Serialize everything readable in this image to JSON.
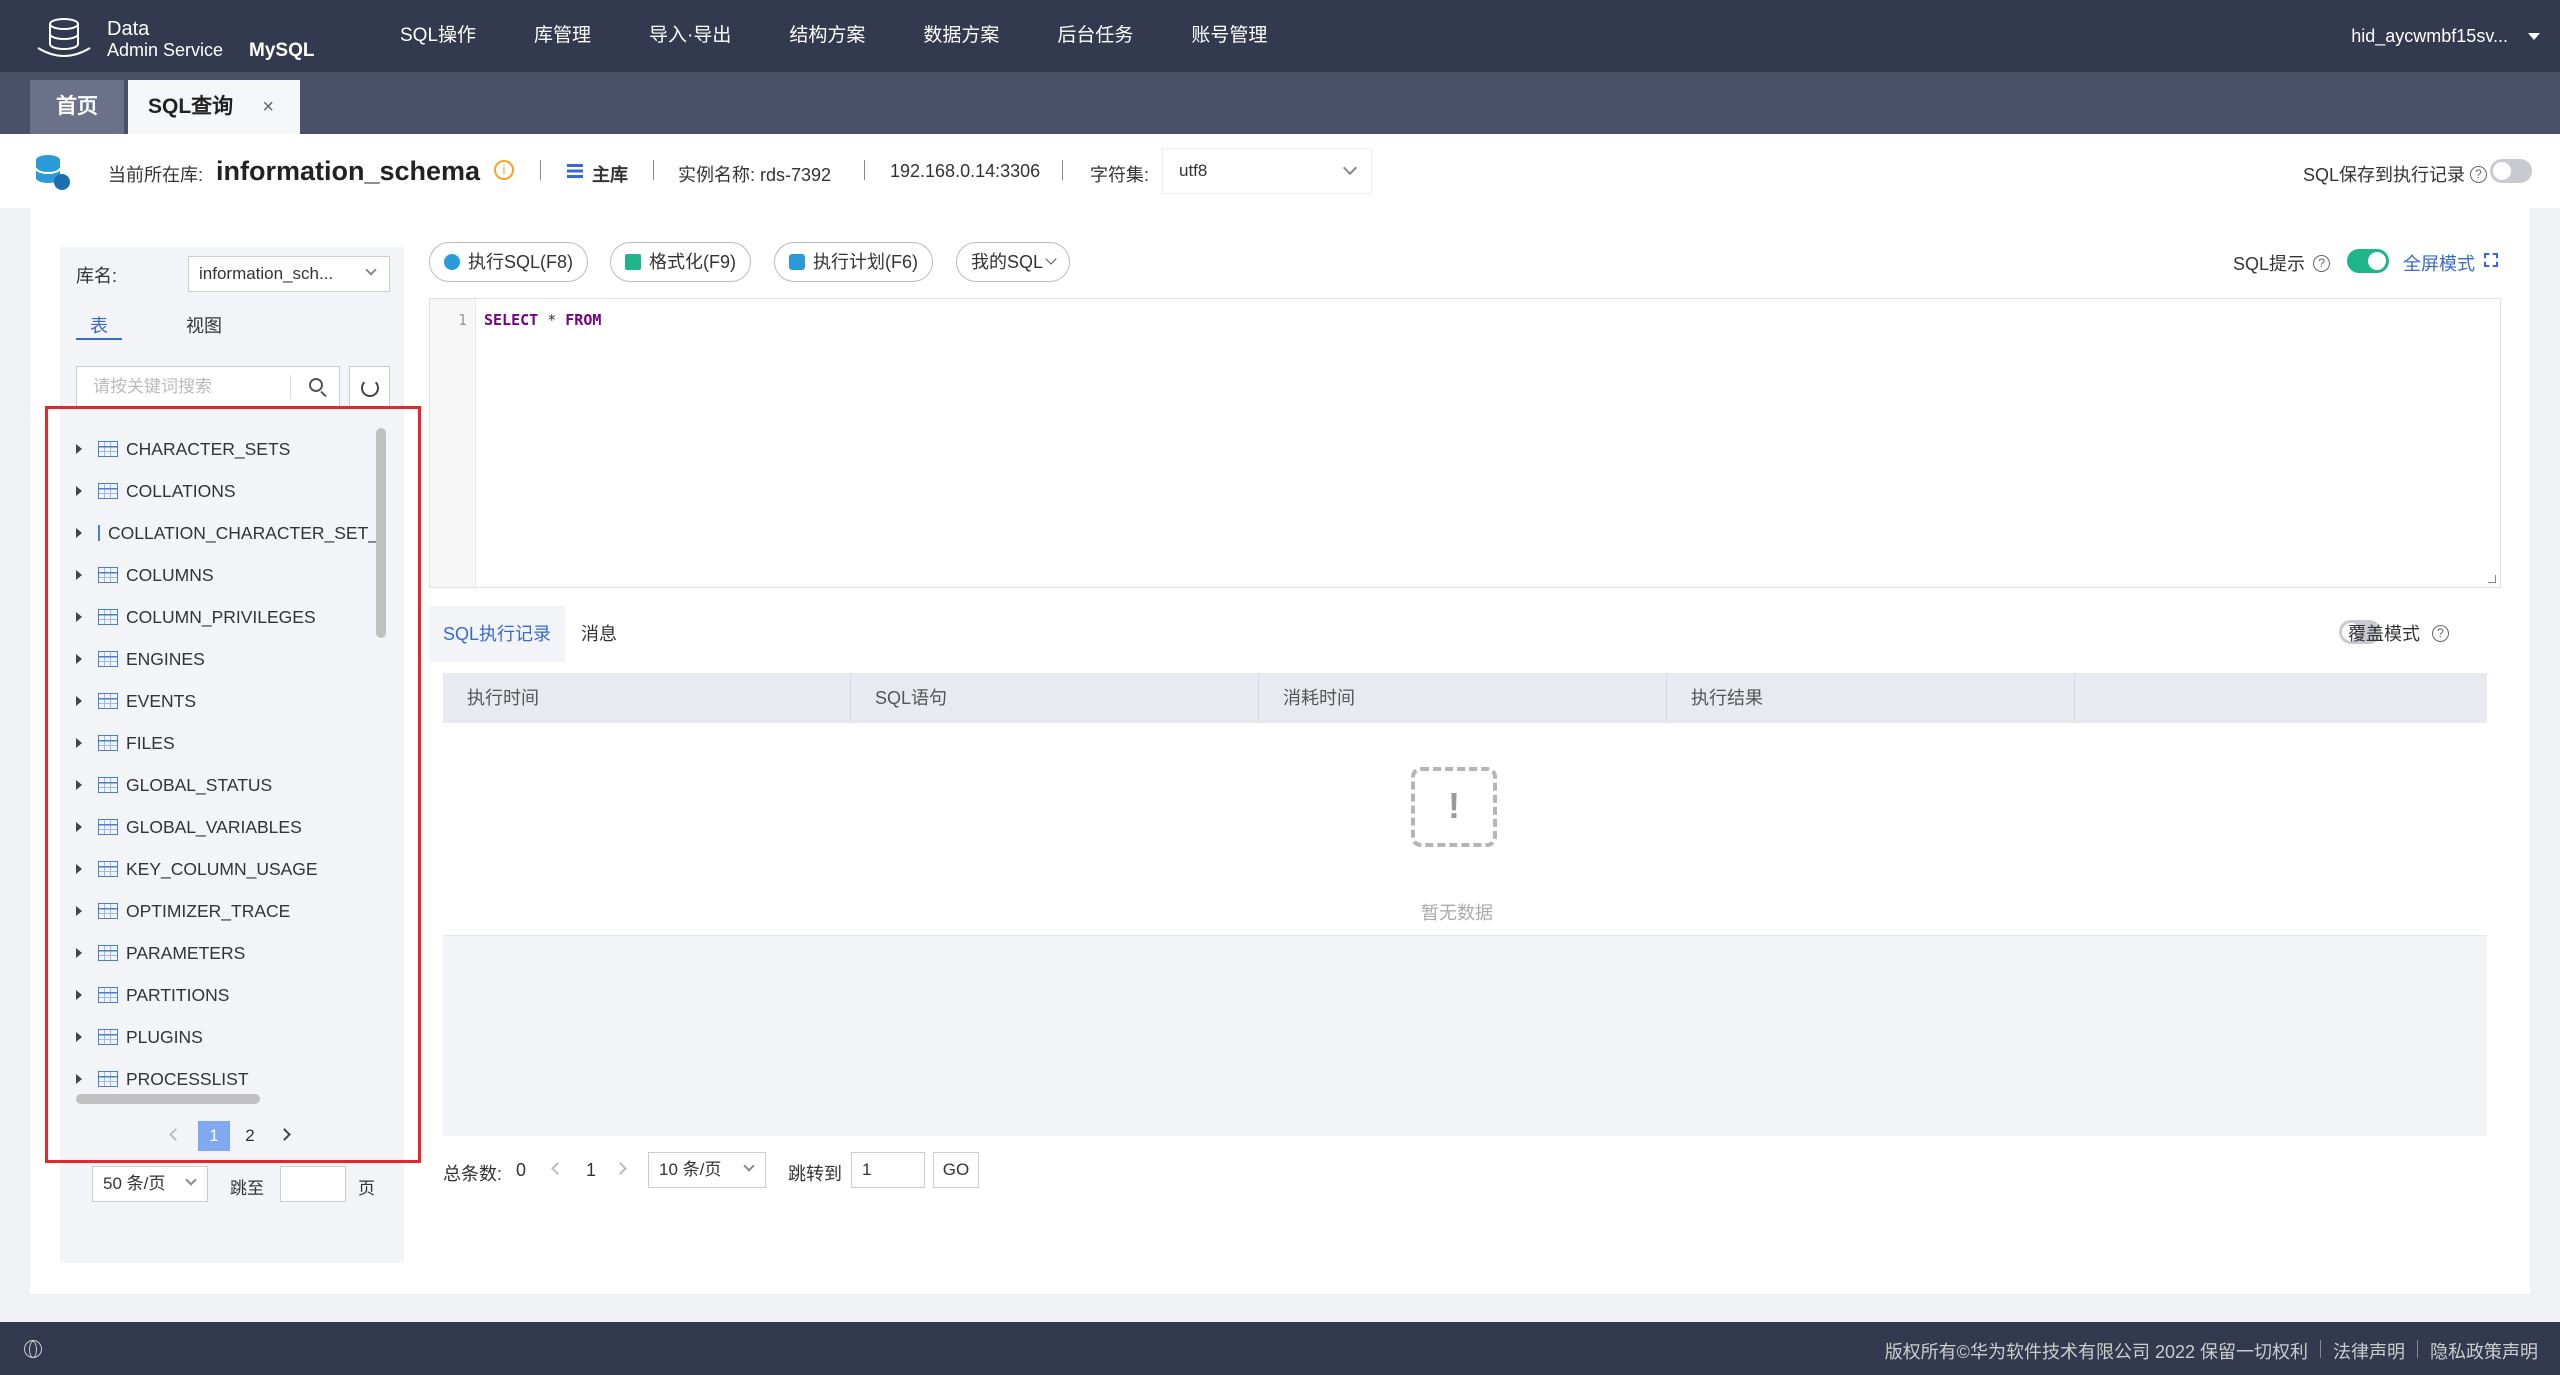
{
  "header": {
    "brand_line1": "Data",
    "brand_line2": "Admin Service",
    "brand_engine": "MySQL",
    "nav": [
      "SQL操作",
      "库管理",
      "导入·导出",
      "结构方案",
      "数据方案",
      "后台任务",
      "账号管理"
    ],
    "user": "hid_aycwmbf15sv..."
  },
  "tabs": {
    "home": "首页",
    "sql": "SQL查询",
    "close": "×"
  },
  "info": {
    "current_db_label": "当前所在库:",
    "db_name": "information_schema",
    "master": "主库",
    "instance": "实例名称:  rds-7392",
    "address": "192.168.0.14:3306",
    "charset_label": "字符集:",
    "charset": "utf8",
    "save_record": "SQL保存到执行记录"
  },
  "left": {
    "db_label": "库名:",
    "db_select": "information_sch...",
    "tab_table": "表",
    "tab_view": "视图",
    "search_placeholder": "请按关键词搜索",
    "tables": [
      "CHARACTER_SETS",
      "COLLATIONS",
      "COLLATION_CHARACTER_SET_APPLICABILITY",
      "COLUMNS",
      "COLUMN_PRIVILEGES",
      "ENGINES",
      "EVENTS",
      "FILES",
      "GLOBAL_STATUS",
      "GLOBAL_VARIABLES",
      "KEY_COLUMN_USAGE",
      "OPTIMIZER_TRACE",
      "PARAMETERS",
      "PARTITIONS",
      "PLUGINS",
      "PROCESSLIST"
    ],
    "page1": "1",
    "page2": "2",
    "page_size": "50 条/页",
    "jump": "跳至",
    "page_unit": "页"
  },
  "toolbar": {
    "exec": "执行SQL(F8)",
    "format": "格式化(F9)",
    "plan": "执行计划(F6)",
    "mysql": "我的SQL",
    "sql_tip": "SQL提示",
    "fullscreen": "全屏模式"
  },
  "editor": {
    "line": "1",
    "kw1": "SELECT",
    "star": " * ",
    "kw2": "FROM"
  },
  "result": {
    "tab_history": "SQL执行记录",
    "tab_msg": "消息",
    "cover": "覆盖模式",
    "columns": [
      "执行时间",
      "SQL语句",
      "消耗时间",
      "执行结果"
    ],
    "empty": "暂无数据",
    "total_label": "总条数:",
    "total": "0",
    "page": "1",
    "page_size": "10 条/页",
    "jump_label": "跳转到",
    "jump_value": "1",
    "go": "GO"
  },
  "footer": {
    "copyright": "版权所有©华为软件技术有限公司 2022 保留一切权利",
    "legal": "法律声明",
    "privacy": "隐私政策声明"
  },
  "colors": {
    "accent": "#3769d6",
    "highlight_box": "#e8262a",
    "toggle_on": "#1fb588",
    "topbar": "#333a4f"
  }
}
